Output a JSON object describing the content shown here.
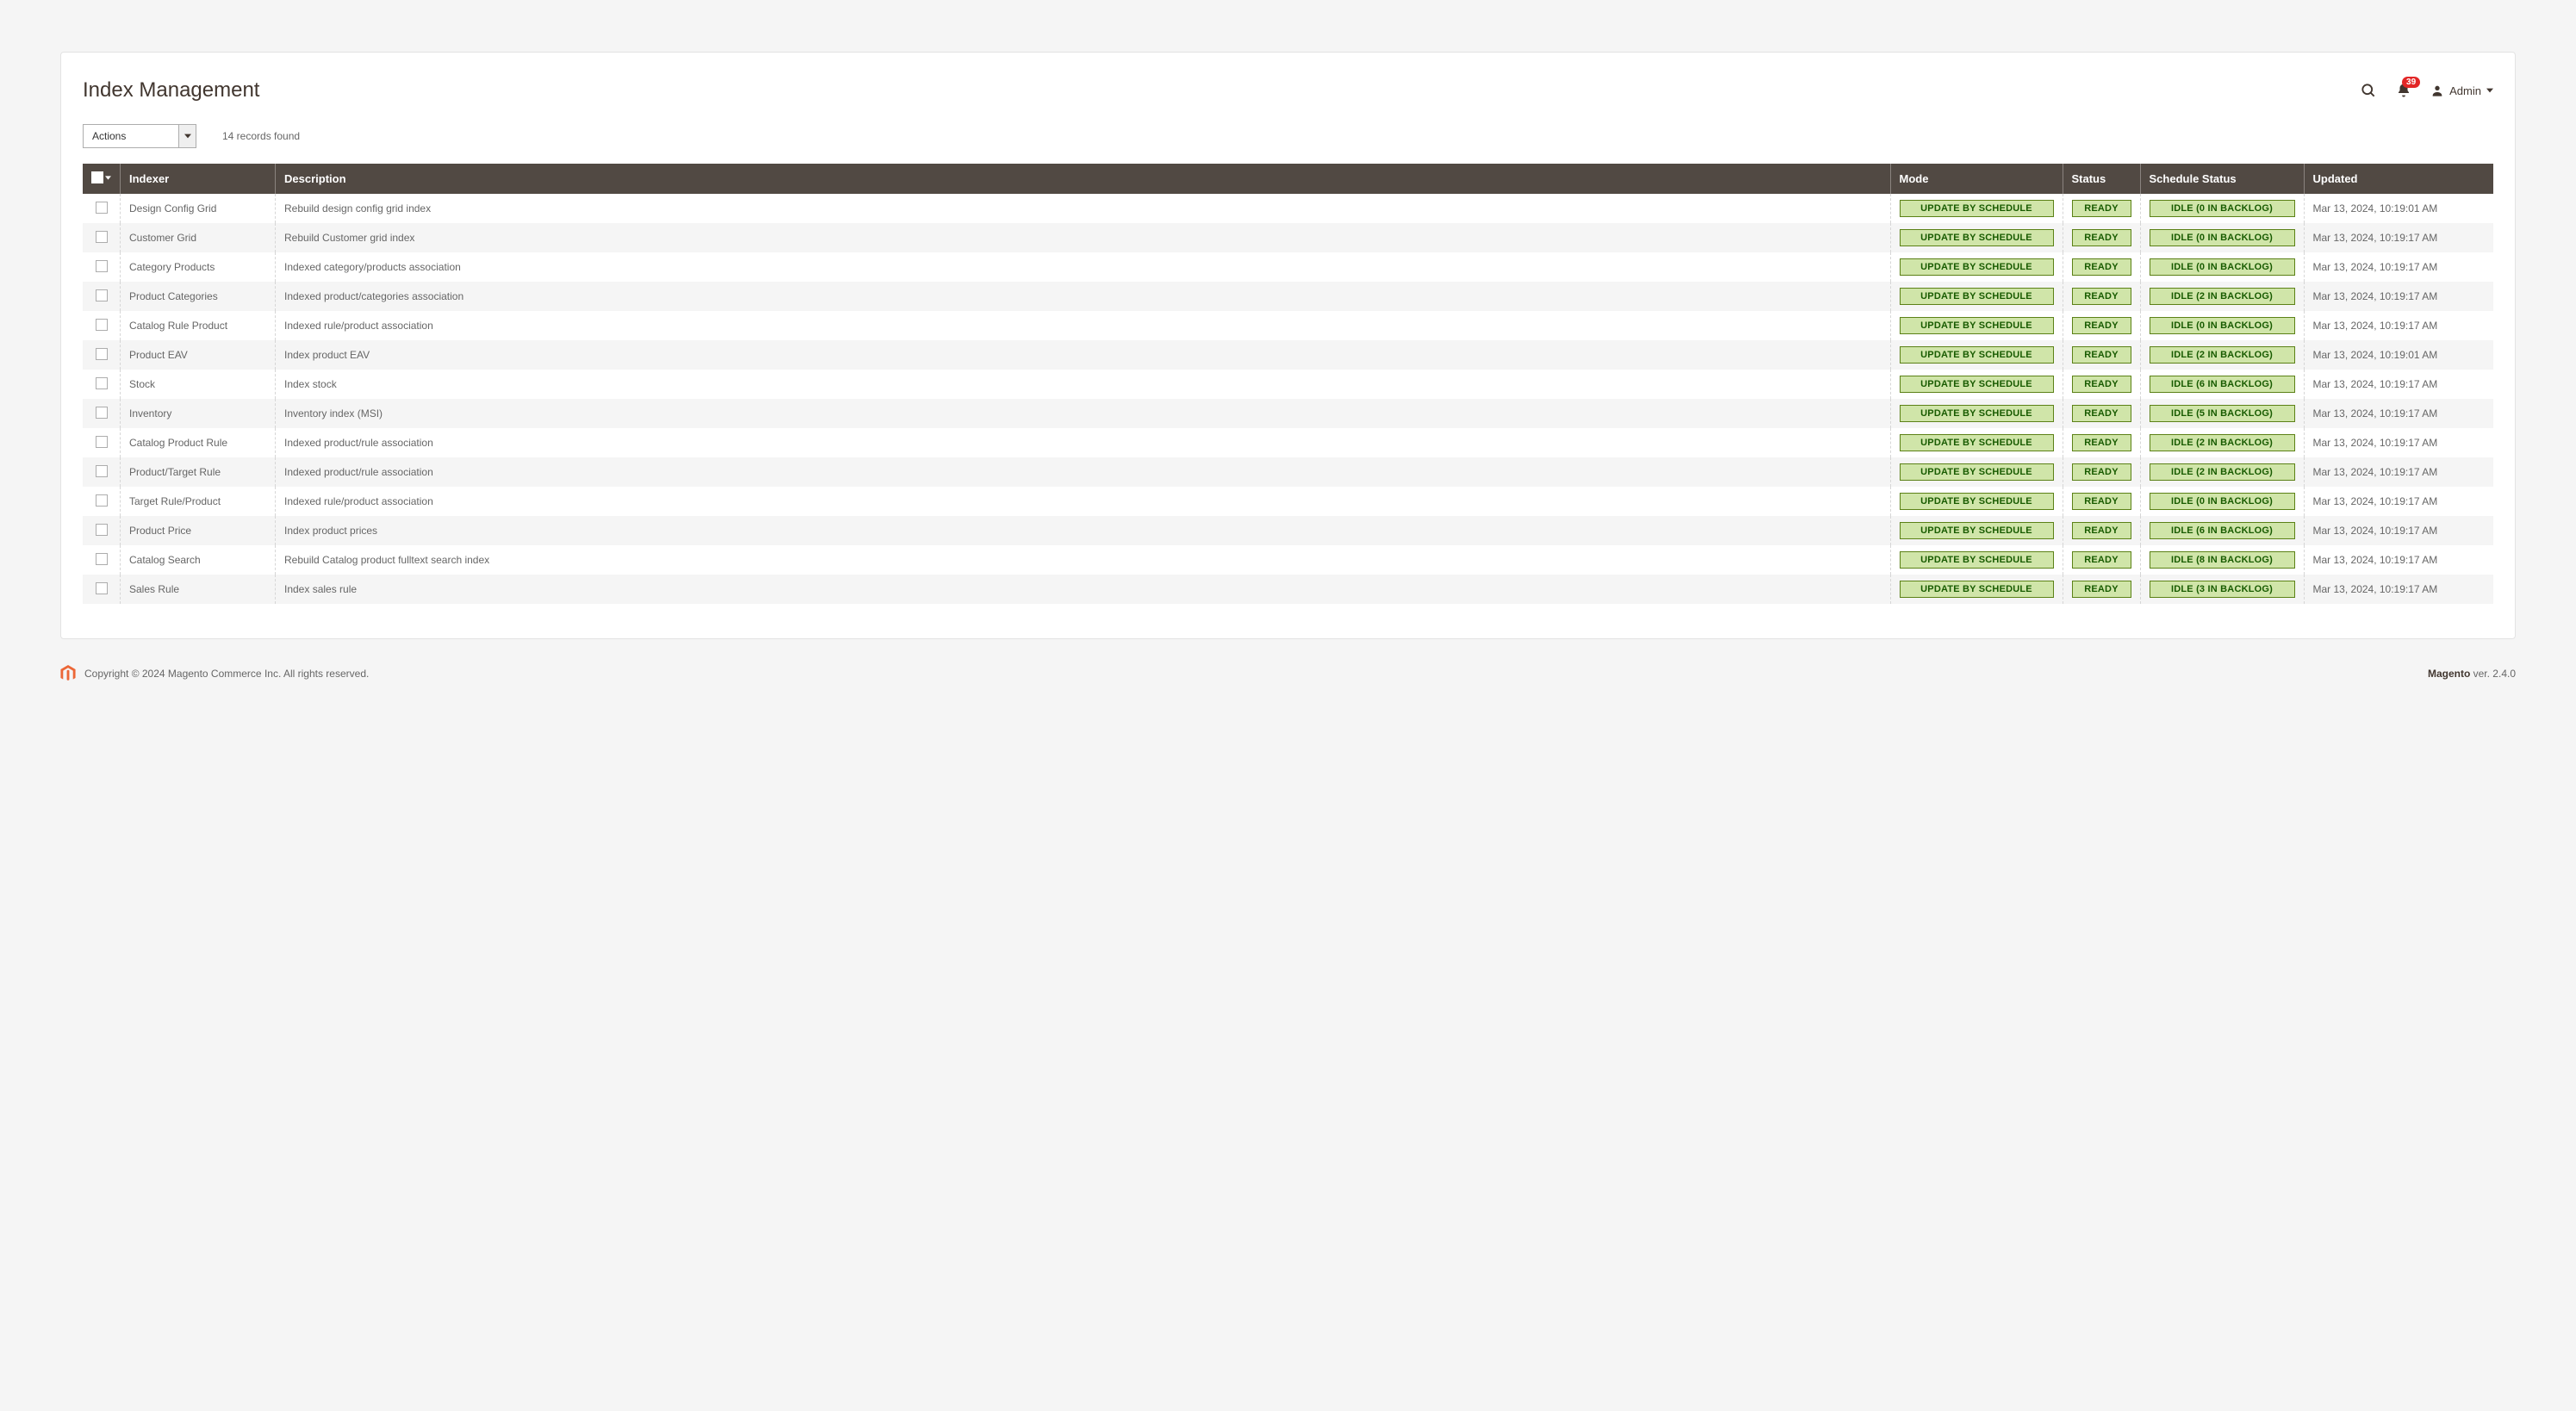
{
  "header": {
    "title": "Index Management",
    "notification_count": "39",
    "user_label": "Admin"
  },
  "toolbar": {
    "actions_label": "Actions",
    "records_found": "14 records found"
  },
  "columns": {
    "indexer": "Indexer",
    "description": "Description",
    "mode": "Mode",
    "status": "Status",
    "schedule_status": "Schedule Status",
    "updated": "Updated"
  },
  "rows": [
    {
      "indexer": "Design Config Grid",
      "description": "Rebuild design config grid index",
      "mode": "UPDATE BY SCHEDULE",
      "status": "READY",
      "schedule": "IDLE (0 IN BACKLOG)",
      "updated": "Mar 13, 2024, 10:19:01 AM"
    },
    {
      "indexer": "Customer Grid",
      "description": "Rebuild Customer grid index",
      "mode": "UPDATE BY SCHEDULE",
      "status": "READY",
      "schedule": "IDLE (0 IN BACKLOG)",
      "updated": "Mar 13, 2024, 10:19:17 AM"
    },
    {
      "indexer": "Category Products",
      "description": "Indexed category/products association",
      "mode": "UPDATE BY SCHEDULE",
      "status": "READY",
      "schedule": "IDLE (0 IN BACKLOG)",
      "updated": "Mar 13, 2024, 10:19:17 AM"
    },
    {
      "indexer": "Product Categories",
      "description": "Indexed product/categories association",
      "mode": "UPDATE BY SCHEDULE",
      "status": "READY",
      "schedule": "IDLE (2 IN BACKLOG)",
      "updated": "Mar 13, 2024, 10:19:17 AM"
    },
    {
      "indexer": "Catalog Rule Product",
      "description": "Indexed rule/product association",
      "mode": "UPDATE BY SCHEDULE",
      "status": "READY",
      "schedule": "IDLE (0 IN BACKLOG)",
      "updated": "Mar 13, 2024, 10:19:17 AM"
    },
    {
      "indexer": "Product EAV",
      "description": "Index product EAV",
      "mode": "UPDATE BY SCHEDULE",
      "status": "READY",
      "schedule": "IDLE (2 IN BACKLOG)",
      "updated": "Mar 13, 2024, 10:19:01 AM"
    },
    {
      "indexer": "Stock",
      "description": "Index stock",
      "mode": "UPDATE BY SCHEDULE",
      "status": "READY",
      "schedule": "IDLE (6 IN BACKLOG)",
      "updated": "Mar 13, 2024, 10:19:17 AM"
    },
    {
      "indexer": "Inventory",
      "description": "Inventory index (MSI)",
      "mode": "UPDATE BY SCHEDULE",
      "status": "READY",
      "schedule": "IDLE (5 IN BACKLOG)",
      "updated": "Mar 13, 2024, 10:19:17 AM"
    },
    {
      "indexer": "Catalog Product Rule",
      "description": "Indexed product/rule association",
      "mode": "UPDATE BY SCHEDULE",
      "status": "READY",
      "schedule": "IDLE (2 IN BACKLOG)",
      "updated": "Mar 13, 2024, 10:19:17 AM"
    },
    {
      "indexer": "Product/Target Rule",
      "description": "Indexed product/rule association",
      "mode": "UPDATE BY SCHEDULE",
      "status": "READY",
      "schedule": "IDLE (2 IN BACKLOG)",
      "updated": "Mar 13, 2024, 10:19:17 AM"
    },
    {
      "indexer": "Target Rule/Product",
      "description": "Indexed rule/product association",
      "mode": "UPDATE BY SCHEDULE",
      "status": "READY",
      "schedule": "IDLE (0 IN BACKLOG)",
      "updated": "Mar 13, 2024, 10:19:17 AM"
    },
    {
      "indexer": "Product Price",
      "description": "Index product prices",
      "mode": "UPDATE BY SCHEDULE",
      "status": "READY",
      "schedule": "IDLE (6 IN BACKLOG)",
      "updated": "Mar 13, 2024, 10:19:17 AM"
    },
    {
      "indexer": "Catalog Search",
      "description": "Rebuild Catalog product fulltext search index",
      "mode": "UPDATE BY SCHEDULE",
      "status": "READY",
      "schedule": "IDLE (8 IN BACKLOG)",
      "updated": "Mar 13, 2024, 10:19:17 AM"
    },
    {
      "indexer": "Sales Rule",
      "description": "Index sales rule",
      "mode": "UPDATE BY SCHEDULE",
      "status": "READY",
      "schedule": "IDLE (3 IN BACKLOG)",
      "updated": "Mar 13, 2024, 10:19:17 AM"
    }
  ],
  "footer": {
    "copyright": "Copyright © 2024 Magento Commerce Inc. All rights reserved.",
    "version_label": "Magento",
    "version_value": " ver. 2.4.0"
  }
}
